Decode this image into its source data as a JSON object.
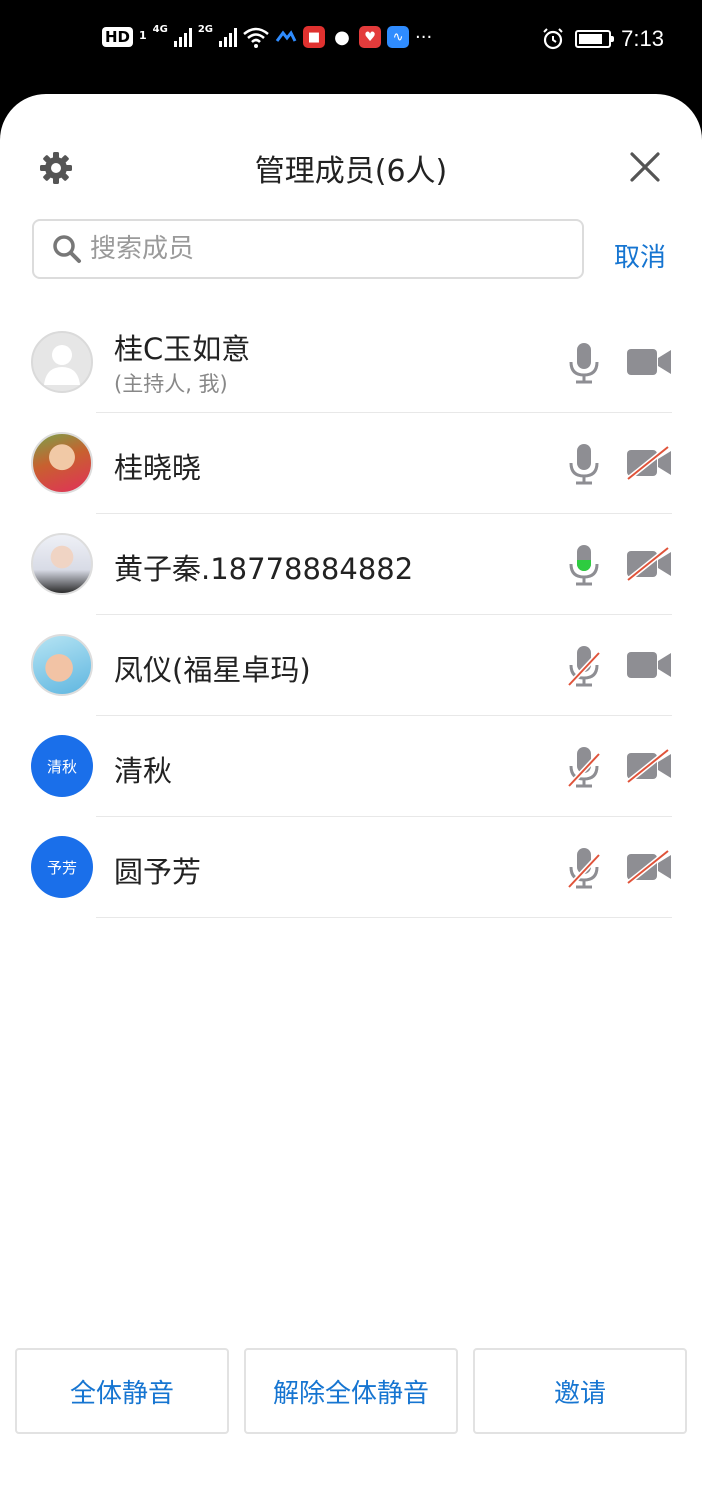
{
  "status_bar": {
    "hd": "HD",
    "sim1": "1",
    "net1": "4G",
    "net2": "2G",
    "more": "···",
    "time": "7:13"
  },
  "header": {
    "title": "管理成员(6人)"
  },
  "search": {
    "placeholder": "搜索成员",
    "cancel_label": "取消"
  },
  "members": [
    {
      "name": "桂C玉如意",
      "role": "(主持人, 我)",
      "avatar_text": "",
      "mic": "on",
      "camera": "on"
    },
    {
      "name": "桂晓晓",
      "role": "",
      "avatar_text": "",
      "mic": "on",
      "camera": "off"
    },
    {
      "name": "黄子秦.18778884882",
      "role": "",
      "avatar_text": "",
      "mic": "speaking",
      "camera": "off"
    },
    {
      "name": "凤仪(福星卓玛)",
      "role": "",
      "avatar_text": "",
      "mic": "off",
      "camera": "on"
    },
    {
      "name": "清秋",
      "role": "",
      "avatar_text": "清秋",
      "mic": "off",
      "camera": "off"
    },
    {
      "name": "圆予芳",
      "role": "",
      "avatar_text": "予芳",
      "mic": "off",
      "camera": "off"
    }
  ],
  "actions": {
    "mute_all": "全体静音",
    "unmute_all": "解除全体静音",
    "invite": "邀请"
  },
  "colors": {
    "accent": "#1675d1",
    "avatar_blue": "#1a6fea",
    "speaking_green": "#2ecc40",
    "off_slash": "#e0533a",
    "icon_grey": "#8e8e93"
  }
}
